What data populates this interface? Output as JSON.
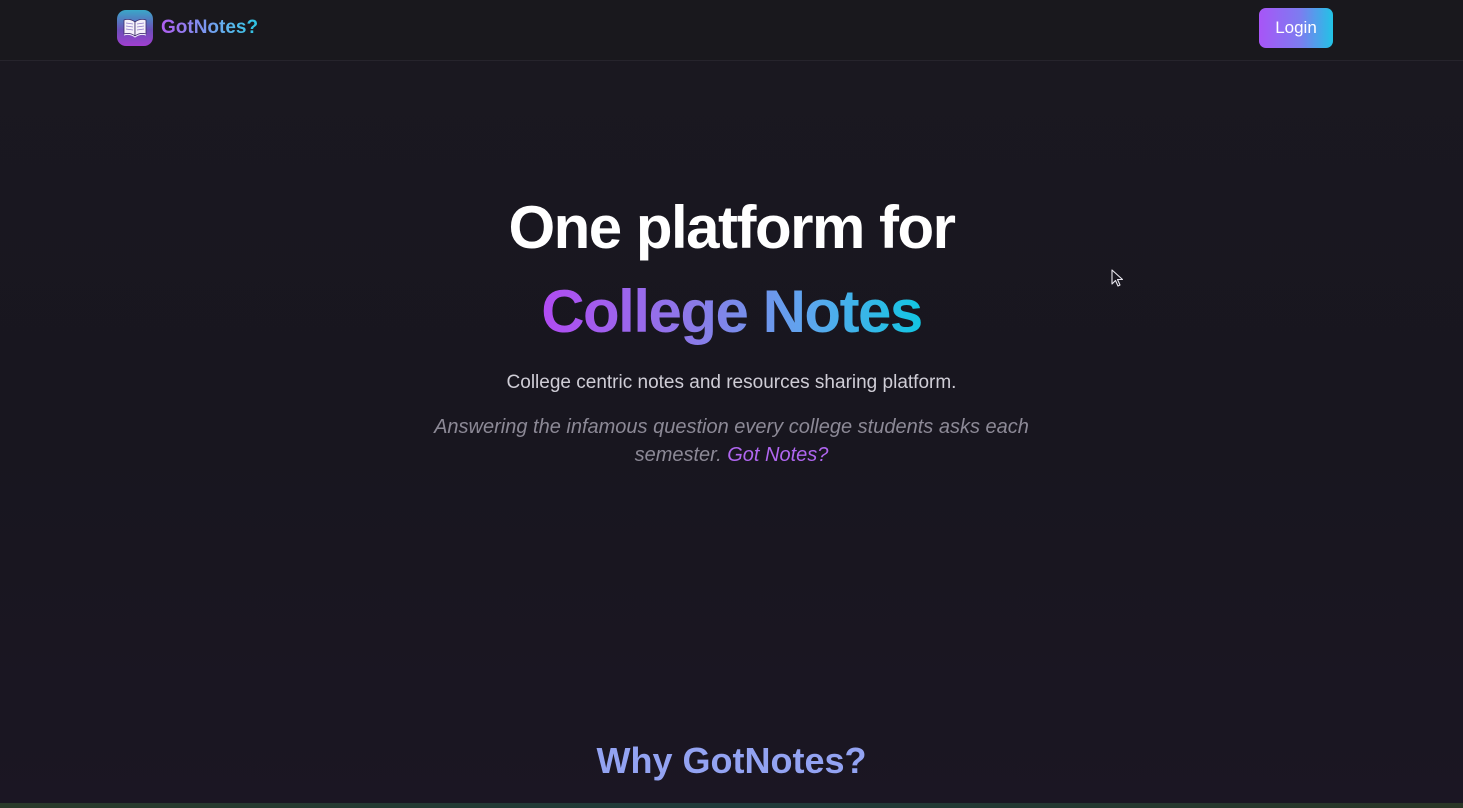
{
  "navbar": {
    "brand_name": "GotNotes?",
    "logo_icon": "open-book-icon",
    "login_label": "Login"
  },
  "hero": {
    "heading_line1": "One platform for",
    "heading_line2": "College Notes",
    "subtitle": "College centric notes and resources sharing platform.",
    "tagline_text": "Answering the infamous question every college students asks each semester.",
    "tagline_link": "Got Notes?"
  },
  "sections": {
    "why_title": "Why GotNotes?"
  },
  "colors": {
    "background": "#18161f",
    "accent_purple": "#a855f7",
    "accent_cyan": "#22c3e6",
    "section_title": "#93a3f2"
  }
}
